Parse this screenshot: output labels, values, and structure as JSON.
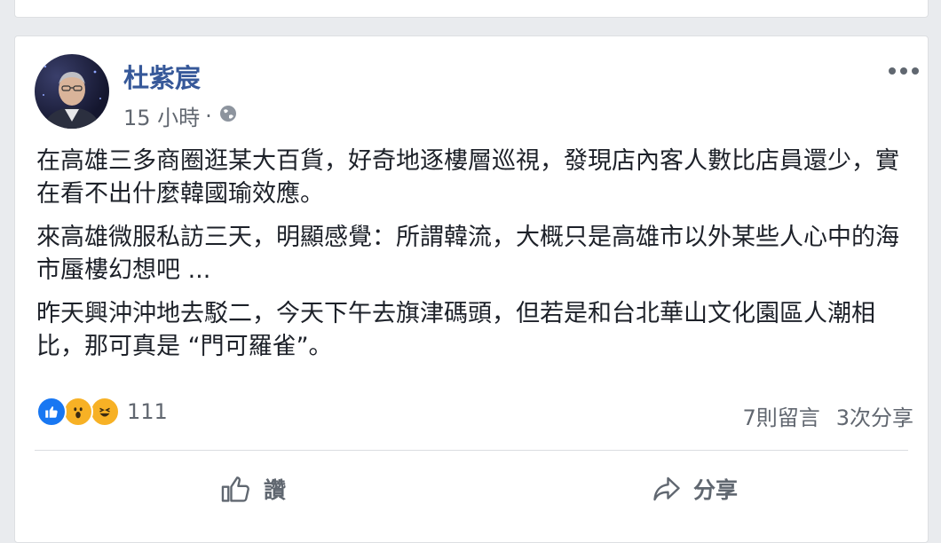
{
  "post": {
    "author": "杜紫宸",
    "time": "15 小時",
    "dot": "·",
    "paragraphs": [
      "在高雄三多商圈逛某大百貨，好奇地逐樓層巡視，發現店內客人數比店員還少，實在看不出什麼韓國瑜效應。",
      "來高雄微服私訪三天，明顯感覺：所謂韓流，大概只是高雄市以外某些人心中的海市蜃樓幻想吧 ...",
      "昨天興沖沖地去駁二，今天下午去旗津碼頭，但若是和台北華山文化園區人潮相比，那可真是 “門可羅雀”。"
    ],
    "reactions": {
      "icons": [
        "like-reaction-icon",
        "wow-reaction-icon",
        "haha-reaction-icon"
      ],
      "count": "111"
    },
    "comments": "7則留言",
    "shares": "3次分享",
    "actions": {
      "like_label": "讚",
      "share_label": "分享"
    },
    "colors": {
      "author": "#365899",
      "like_blue": "#1877f2",
      "emoji_yellow": "#f7b125",
      "secondary_text": "#616770"
    }
  }
}
